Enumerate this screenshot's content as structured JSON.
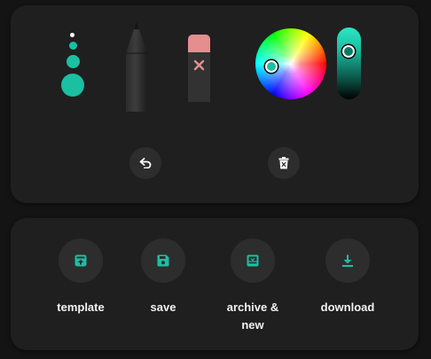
{
  "drawing_tools": {
    "brush_sizes": [
      "extra-small",
      "small",
      "medium",
      "large"
    ],
    "selected_size": "extra-small",
    "tools": [
      {
        "name": "pencil-icon",
        "selected": true
      },
      {
        "name": "eraser-icon",
        "selected": false
      }
    ],
    "accent_color": "#1bbfa2",
    "selected_color": "#1bbfa2",
    "undo_icon": "undo-icon",
    "clear_icon": "trash-icon"
  },
  "actions": [
    {
      "icon": "template-icon",
      "label": "template"
    },
    {
      "icon": "save-icon",
      "label": "save"
    },
    {
      "icon": "archive-icon",
      "label": "archive & new"
    },
    {
      "icon": "download-icon",
      "label": "download"
    }
  ]
}
